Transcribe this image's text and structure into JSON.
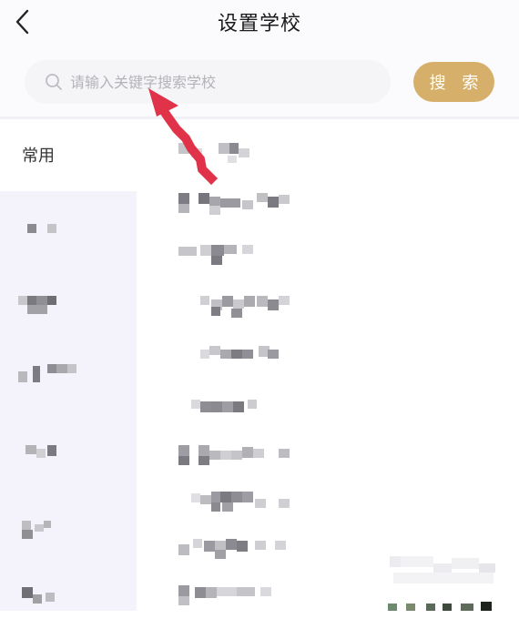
{
  "header": {
    "title": "设置学校",
    "back_icon": "chevron-left-icon"
  },
  "search": {
    "placeholder": "请输入关键字搜索学校",
    "value": "",
    "button_label": "搜 索",
    "icon": "search-icon",
    "button_color": "#d6b06a"
  },
  "sidebar": {
    "header_label": "常用",
    "items": [
      {
        "label": ""
      },
      {
        "label": ""
      },
      {
        "label": ""
      },
      {
        "label": ""
      },
      {
        "label": ""
      },
      {
        "label": ""
      }
    ]
  },
  "schools": [
    {
      "name": ""
    },
    {
      "name": ""
    },
    {
      "name": ""
    },
    {
      "name": ""
    },
    {
      "name": ""
    },
    {
      "name": ""
    },
    {
      "name": ""
    },
    {
      "name": ""
    },
    {
      "name": ""
    },
    {
      "name": ""
    }
  ],
  "annotation": {
    "arrow_color": "#e0334a",
    "arrow_icon": "red-arrow-annotation"
  },
  "colors": {
    "accent": "#d6b06a",
    "sidebar_bg": "#f4f3fb",
    "search_bg": "#f5f5f8"
  }
}
